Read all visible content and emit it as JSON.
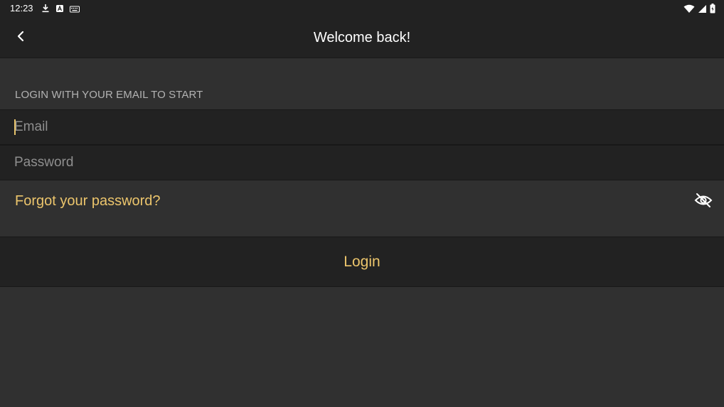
{
  "status_bar": {
    "time": "12:23",
    "left_icons": [
      "download-icon",
      "app-badge-icon",
      "keyboard-icon"
    ],
    "right_icons": [
      "wifi-icon",
      "signal-icon",
      "battery-icon"
    ]
  },
  "header": {
    "title": "Welcome back!",
    "back_icon": "back-arrow-icon"
  },
  "form": {
    "section_label": "LOGIN WITH YOUR EMAIL TO START",
    "email": {
      "value": "",
      "placeholder": "Email"
    },
    "password": {
      "value": "",
      "placeholder": "Password"
    },
    "forgot_label": "Forgot your password?",
    "visibility_icon": "eye-off-icon",
    "login_label": "Login"
  },
  "colors": {
    "accent": "#ecc56c",
    "background": "#303030",
    "surface": "#222222"
  }
}
